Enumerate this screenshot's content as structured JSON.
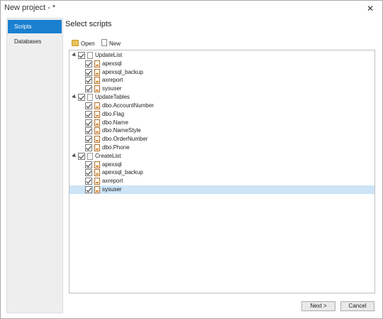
{
  "window": {
    "title": "New project - *",
    "close_label": "✕"
  },
  "sidebar": {
    "items": [
      {
        "label": "Scripts",
        "active": true
      },
      {
        "label": "Databases",
        "active": false
      }
    ]
  },
  "main": {
    "title": "Select scripts"
  },
  "toolbar": {
    "open_label": "Open",
    "new_label": "New"
  },
  "tree": {
    "groups": [
      {
        "label": "UpdateList",
        "checked": true,
        "items": [
          {
            "label": "apexsql",
            "checked": true
          },
          {
            "label": "apexsql_backup",
            "checked": true
          },
          {
            "label": "axreport",
            "checked": true
          },
          {
            "label": "sysuser",
            "checked": true
          }
        ]
      },
      {
        "label": "UpdateTables",
        "checked": true,
        "items": [
          {
            "label": "dbo.AccountNumber",
            "checked": true
          },
          {
            "label": "dbo.Flag",
            "checked": true
          },
          {
            "label": "dbo.Name",
            "checked": true
          },
          {
            "label": "dbo.NameStyle",
            "checked": true
          },
          {
            "label": "dbo.OrderNumber",
            "checked": true
          },
          {
            "label": "dbo.Phone",
            "checked": true
          }
        ]
      },
      {
        "label": "CreateList",
        "checked": true,
        "items": [
          {
            "label": "apexsql",
            "checked": true
          },
          {
            "label": "apexsql_backup",
            "checked": true
          },
          {
            "label": "axreport",
            "checked": true
          },
          {
            "label": "sysuser",
            "checked": true,
            "selected": true
          }
        ]
      }
    ]
  },
  "footer": {
    "next_label": "Next >",
    "cancel_label": "Cancel"
  },
  "colors": {
    "accent": "#1a80d0",
    "selection": "#cde4f7"
  }
}
